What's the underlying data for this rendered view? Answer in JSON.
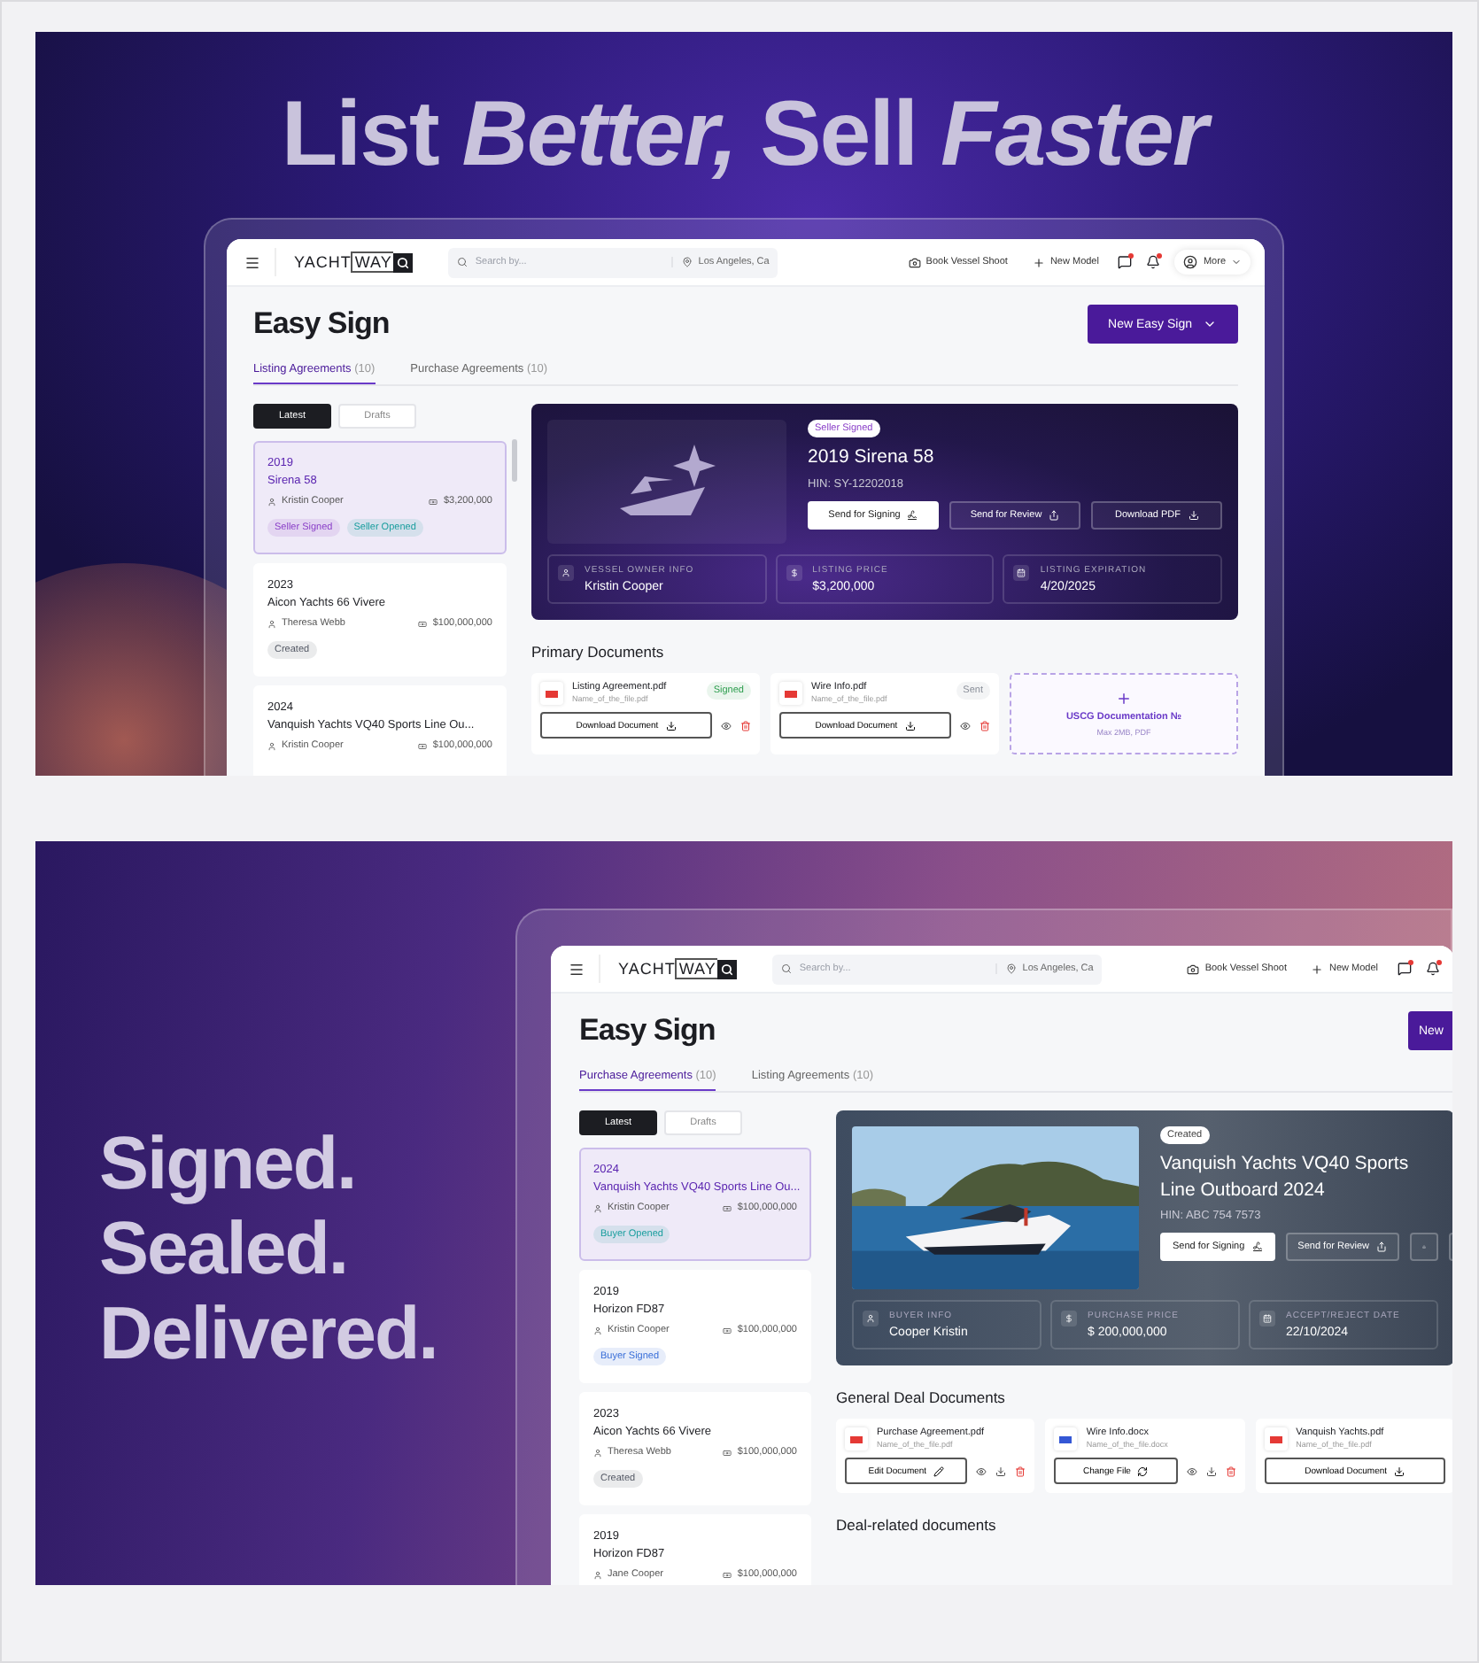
{
  "panels": [
    {
      "headline": [
        "List *Better,* Sell *Faster*"
      ],
      "screen": {
        "nav": {
          "logo_left": "YACHT",
          "logo_right": "WAY",
          "search_placeholder": "Search by...",
          "location": "Los Angeles, Ca",
          "actions": [
            "Book Vessel Shoot",
            "New Model"
          ],
          "chat_unread": true,
          "bell_unread": true,
          "more": "More"
        },
        "title": "Easy Sign",
        "primary_button": "New Easy Sign",
        "tabs": [
          {
            "label": "Listing Agreements",
            "count": "(10)",
            "selected": true
          },
          {
            "label": "Purchase Agreements",
            "count": "(10)",
            "selected": false
          }
        ],
        "filters": [
          {
            "label": "Latest",
            "selected": true
          },
          {
            "label": "Drafts",
            "selected": false
          }
        ],
        "deals": [
          {
            "year": "2019",
            "name": "Sirena 58",
            "owner": "Kristin Cooper",
            "price": "$3,200,000",
            "selected": true,
            "tags": [
              {
                "label": "Seller Signed",
                "color": "#8a3fc8"
              },
              {
                "label": "Seller Opened",
                "color": "#1a9e9e"
              }
            ]
          },
          {
            "year": "2023",
            "name": "Aicon Yachts 66 Vivere",
            "owner": "Theresa Webb",
            "price": "$100,000,000",
            "selected": false,
            "tags": [
              {
                "label": "Created",
                "color": "#555a66"
              }
            ]
          },
          {
            "year": "2024",
            "name": "Vanquish Yachts VQ40 Sports Line Ou...",
            "owner": "Kristin Cooper",
            "price": "$100,000,000",
            "selected": false
          }
        ],
        "hero": {
          "status": "Seller Signed",
          "title": "2019 Sirena 58",
          "hin": "HIN: SY-12202018",
          "actions": [
            "Send for Signing",
            "Send for Review",
            "Download PDF"
          ],
          "info": [
            {
              "label": "VESSEL OWNER INFO",
              "value": "Kristin Cooper"
            },
            {
              "label": "LISTING PRICE",
              "value": "$3,200,000"
            },
            {
              "label": "LISTING EXPIRATION",
              "value": "4/20/2025"
            }
          ]
        },
        "sections": [
          {
            "title": "Primary Documents",
            "docs": [
              {
                "kind": "file",
                "name": "Listing Agreement.pdf",
                "file": "Name_of_the_file.pdf",
                "color": "#e53935",
                "status": {
                  "label": "Signed",
                  "color": "#2e9e4f"
                },
                "button": "Download Document"
              },
              {
                "kind": "file",
                "name": "Wire Info.pdf",
                "file": "Name_of_the_file.pdf",
                "color": "#e53935",
                "status": {
                  "label": "Sent",
                  "color": "#8a8f99"
                },
                "button": "Download Document"
              },
              {
                "kind": "upload",
                "name": "USCG Documentation №",
                "file": "Max 2MB, PDF"
              }
            ]
          }
        ]
      }
    },
    {
      "headline": [
        "Signed.",
        "Sealed.",
        "Delivered."
      ],
      "screen": {
        "nav": {
          "logo_left": "YACHT",
          "logo_right": "WAY",
          "search_placeholder": "Search by...",
          "location": "Los Angeles, Ca",
          "actions": [
            "Book Vessel Shoot",
            "New Model"
          ],
          "chat_unread": true,
          "bell_unread": true
        },
        "title": "Easy Sign",
        "primary_button": "New",
        "tabs": [
          {
            "label": "Purchase Agreements",
            "count": "(10)",
            "selected": true
          },
          {
            "label": "Listing Agreements",
            "count": "(10)",
            "selected": false
          }
        ],
        "filters": [
          {
            "label": "Latest",
            "selected": true
          },
          {
            "label": "Drafts",
            "selected": false
          }
        ],
        "deals": [
          {
            "year": "2024",
            "name": "Vanquish Yachts VQ40 Sports Line Ou...",
            "owner": "Kristin Cooper",
            "price": "$100,000,000",
            "selected": true,
            "tags": [
              {
                "label": "Buyer Opened",
                "color": "#1a9e9e"
              }
            ]
          },
          {
            "year": "2019",
            "name": "Horizon FD87",
            "owner": "Kristin Cooper",
            "price": "$100,000,000",
            "selected": false,
            "tags": [
              {
                "label": "Buyer Signed",
                "color": "#3a6fd8"
              }
            ]
          },
          {
            "year": "2023",
            "name": "Aicon Yachts 66 Vivere",
            "owner": "Theresa Webb",
            "price": "$100,000,000",
            "selected": false,
            "tags": [
              {
                "label": "Created",
                "color": "#555a66"
              }
            ]
          },
          {
            "year": "2019",
            "name": "Horizon FD87",
            "owner": "Jane Cooper",
            "price": "$100,000,000",
            "selected": false
          }
        ],
        "hero": {
          "status": "Created",
          "title": "Vanquish Yachts VQ40 Sports Line Outboard 2024",
          "hin": "HIN: ABC 754 7573",
          "actions": [
            "Send for Signing",
            "Send for Review"
          ],
          "info": [
            {
              "label": "BUYER INFO",
              "value": "Cooper Kristin"
            },
            {
              "label": "PURCHASE PRICE",
              "value": "$ 200,000,000"
            },
            {
              "label": "ACCEPT/REJECT DATE",
              "value": "22/10/2024"
            }
          ]
        },
        "sections": [
          {
            "title": "General Deal Documents",
            "docs": [
              {
                "kind": "file",
                "name": "Purchase Agreement.pdf",
                "file": "Name_of_the_file.pdf",
                "color": "#e53935",
                "button": "Edit Document"
              },
              {
                "kind": "file",
                "name": "Wire Info.docx",
                "file": "Name_of_the_file.docx",
                "color": "#3457d5",
                "button": "Change File"
              },
              {
                "kind": "file",
                "name": "Vanquish Yachts.pdf",
                "file": "Name_of_the_file.pdf",
                "color": "#e53935",
                "button": "Download Document"
              }
            ]
          },
          {
            "title": "Deal-related documents"
          }
        ]
      }
    }
  ]
}
